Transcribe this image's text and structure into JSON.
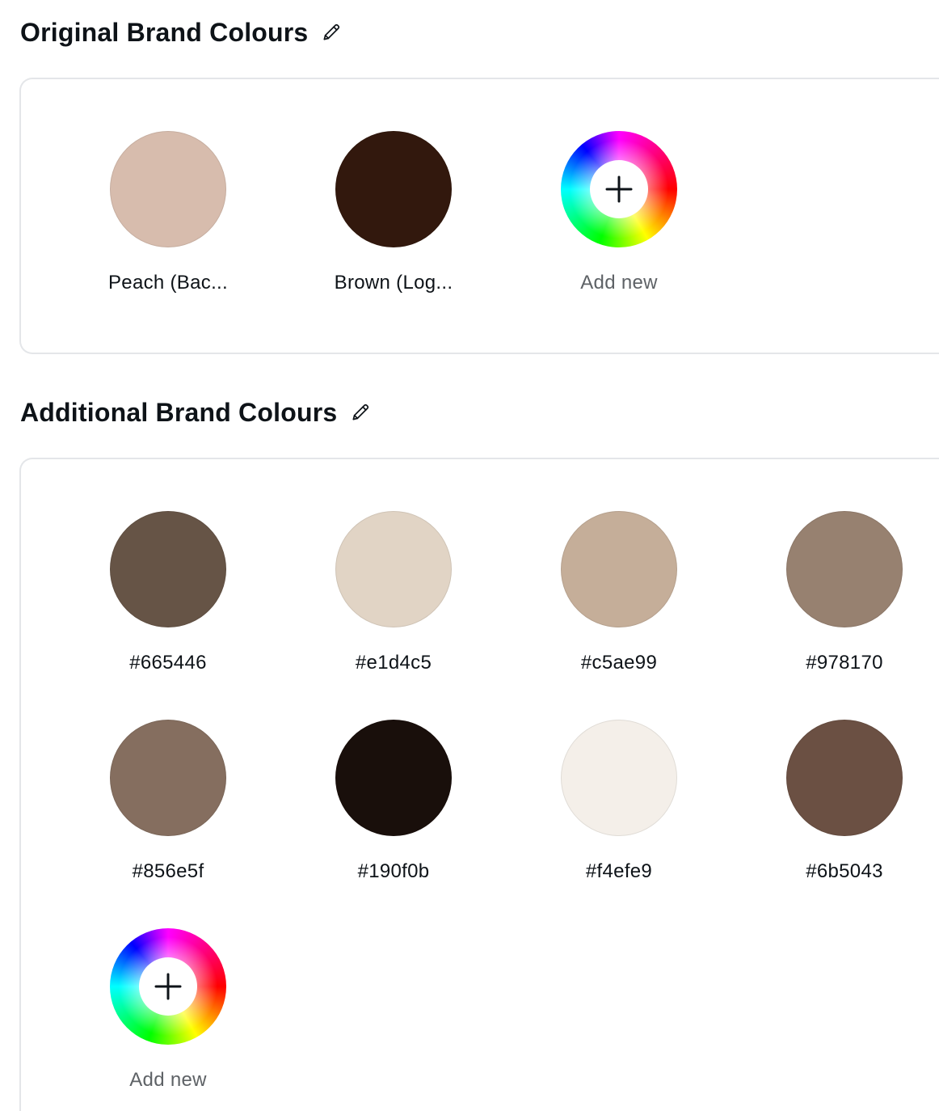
{
  "original": {
    "title": "Original Brand Colours",
    "edit_icon": "pencil-icon",
    "swatches": [
      {
        "label": "Peach (Bac...",
        "color": "#d7bcad"
      },
      {
        "label": "Brown (Log...",
        "color": "#32180d"
      }
    ],
    "add_label": "Add new",
    "add_icon": "plus-icon"
  },
  "additional": {
    "title": "Additional Brand Colours",
    "edit_icon": "pencil-icon",
    "swatches": [
      {
        "label": "#665446",
        "color": "#665446"
      },
      {
        "label": "#e1d4c5",
        "color": "#e1d4c5"
      },
      {
        "label": "#c5ae99",
        "color": "#c5ae99"
      },
      {
        "label": "#978170",
        "color": "#978170"
      },
      {
        "label": "#856e5f",
        "color": "#856e5f"
      },
      {
        "label": "#190f0b",
        "color": "#190f0b"
      },
      {
        "label": "#f4efe9",
        "color": "#f4efe9"
      },
      {
        "label": "#6b5043",
        "color": "#6b5043"
      }
    ],
    "add_label": "Add new",
    "add_icon": "plus-icon"
  }
}
